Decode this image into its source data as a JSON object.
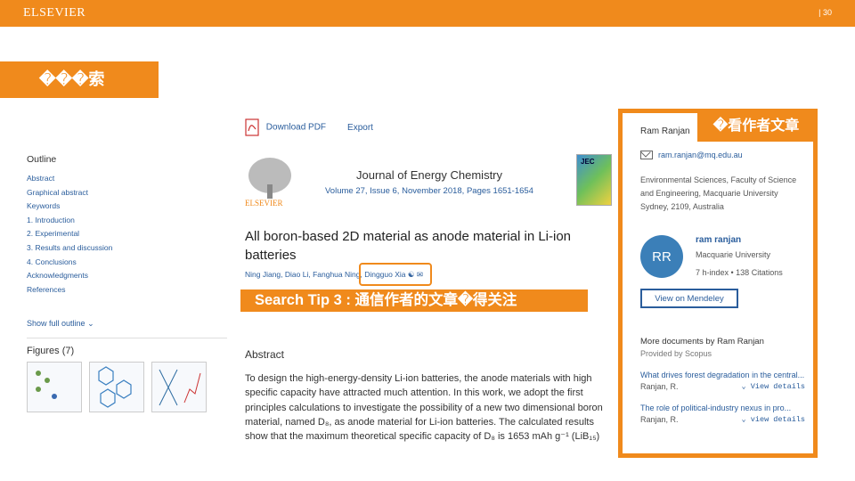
{
  "slide": {
    "brand": "ELSEVIER",
    "page_number": "| 30",
    "title": "���索",
    "tip": "Search Tip 3 : 通信作者的文章�得关注",
    "view_label": "�看作者文章"
  },
  "toolbar": {
    "download_pdf": "Download PDF",
    "export": "Export"
  },
  "outline": {
    "heading": "Outline",
    "items": [
      "Abstract",
      "Graphical abstract",
      "Keywords",
      "1. Introduction",
      "2. Experimental",
      "3. Results and discussion",
      "4. Conclusions",
      "Acknowledgments",
      "References"
    ],
    "show_full": "Show full outline",
    "figures": "Figures (7)"
  },
  "article": {
    "journal": "Journal of Energy Chemistry",
    "volume": "Volume 27, Issue 6, November 2018, Pages 1651-1654",
    "publisher": "ELSEVIER",
    "cover_label": "JEC",
    "title": "All boron-based 2D material as anode material in Li-ion batteries",
    "authors": "Ning Jiang, Diao Li, Fanghua Ning, Dingguo Xia",
    "abstract_heading": "Abstract",
    "abstract_lines": [
      "To design the high-energy-density Li-ion batteries, the anode materials with high",
      "specific capacity have attracted much attention. In this work, we adopt the first",
      "principles calculations to investigate the possibility of a new two dimensional boron",
      "material, named D₈, as anode material for Li-ion batteries. The calculated results",
      "show that the maximum theoretical specific capacity of D₈ is 1653 mAh g⁻¹ (LiB₁₅)"
    ]
  },
  "author_panel": {
    "name": "Ram Ranjan",
    "email": "ram.ranjan@mq.edu.au",
    "affiliation": "Environmental Sciences, Faculty of Science and Engineering, Macquarie University Sydney, 2109, Australia",
    "avatar_initials": "RR",
    "profile_name": "ram ranjan",
    "profile_uni": "Macquarie University",
    "profile_stats": "7 h-index • 138 Citations",
    "view_mendeley": "View on Mendeley",
    "more_docs": "More documents by Ram Ranjan",
    "provided_by": "Provided by Scopus",
    "docs": [
      {
        "title": "What drives forest degradation in the central...",
        "author": "Ranjan, R.",
        "details": "View details"
      },
      {
        "title": "The role of political-industry nexus in pro...",
        "author": "Ranjan, R.",
        "details": "view details"
      }
    ]
  },
  "colors": {
    "accent": "#f08a1c",
    "link": "#2a5d9c"
  }
}
